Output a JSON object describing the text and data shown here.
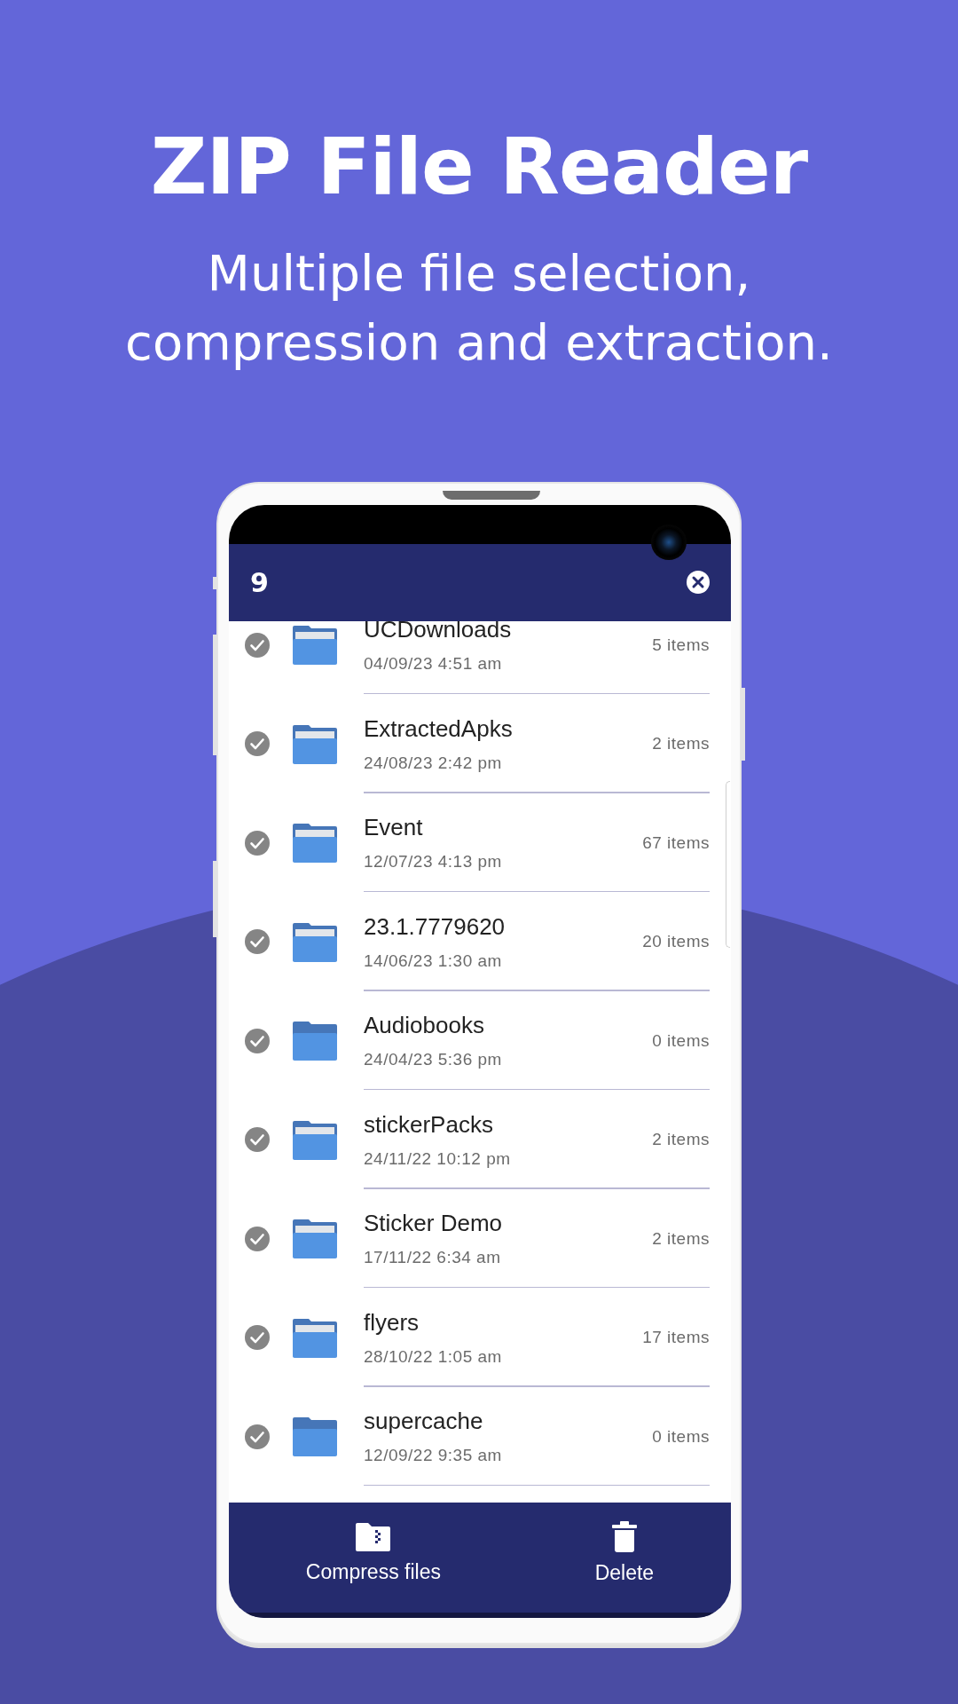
{
  "headline": "ZIP File Reader",
  "subtitle": "Multiple file selection, compression and extraction.",
  "app_bar": {
    "selected_count": "9"
  },
  "files": [
    {
      "name": "UCDownloads",
      "date": "04/09/23  4:51 am",
      "count": "5 items",
      "selected": true,
      "kind": "filled"
    },
    {
      "name": "ExtractedApks",
      "date": "24/08/23  2:42 pm",
      "count": "2 items",
      "selected": true,
      "kind": "filled"
    },
    {
      "name": "Event",
      "date": "12/07/23  4:13 pm",
      "count": "67 items",
      "selected": true,
      "kind": "filled"
    },
    {
      "name": "23.1.7779620",
      "date": "14/06/23  1:30 am",
      "count": "20 items",
      "selected": true,
      "kind": "filled"
    },
    {
      "name": "Audiobooks",
      "date": "24/04/23  5:36 pm",
      "count": "0 items",
      "selected": true,
      "kind": "empty"
    },
    {
      "name": "stickerPacks",
      "date": "24/11/22  10:12 pm",
      "count": "2 items",
      "selected": true,
      "kind": "filled"
    },
    {
      "name": "Sticker Demo",
      "date": "17/11/22  6:34 am",
      "count": "2 items",
      "selected": true,
      "kind": "filled"
    },
    {
      "name": "flyers",
      "date": "28/10/22  1:05 am",
      "count": "17 items",
      "selected": true,
      "kind": "filled"
    },
    {
      "name": "supercache",
      "date": "12/09/22  9:35 am",
      "count": "0 items",
      "selected": true,
      "kind": "empty"
    }
  ],
  "bottom_actions": [
    {
      "label": "Compress files",
      "kind": "compress"
    },
    {
      "label": "Delete",
      "kind": "delete"
    }
  ]
}
